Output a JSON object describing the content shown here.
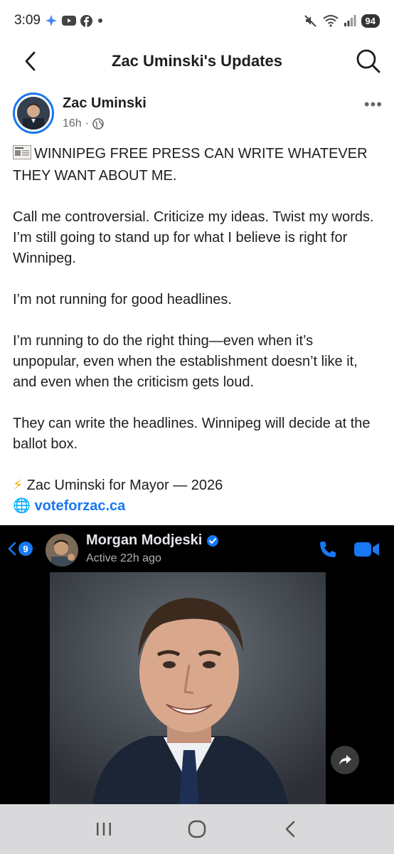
{
  "status_bar": {
    "time": "3:09",
    "battery": "94"
  },
  "header": {
    "title": "Zac Uminski's Updates"
  },
  "post": {
    "author": "Zac Uminski",
    "time_ago": "16h",
    "separator": "·",
    "headline": "WINNIPEG FREE PRESS CAN WRITE WHATEVER THEY WANT ABOUT ME.",
    "p1": "Call me controversial. Criticize my ideas. Twist my words. I’m still going to stand up for what I believe is right for Winnipeg.",
    "p2": "I’m not running for good headlines.",
    "p3": "I’m running to do the right thing—even when it’s unpopular, even when the establishment doesn’t like it, and even when the criticism gets loud.",
    "p4": "They can write the headlines. Winnipeg will decide at the ballot box.",
    "sign_line": "Zac Uminski for Mayor — 2026",
    "link": "voteforzac.ca",
    "bolt_emoji": "⚡",
    "globe_emoji": "🌐"
  },
  "embed": {
    "unread_count": "9",
    "contact_name": "Morgan Modjeski",
    "contact_status": "Active 22h ago"
  },
  "colors": {
    "accent": "#1877f2",
    "text": "#1c1e21",
    "secondary": "#65676b",
    "nav_bg": "#d9d9dc"
  }
}
